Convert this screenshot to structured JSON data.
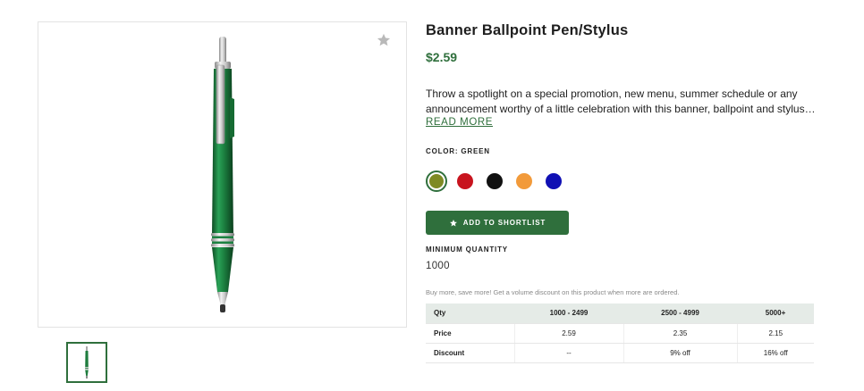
{
  "product": {
    "title": "Banner Ballpoint Pen/Stylus",
    "price": "$2.59",
    "description": "Throw a spotlight on a special promotion, new menu, summer schedule or any announcement worthy of a little celebration with this banner, ballpoint and stylus…",
    "read_more": "READ MORE"
  },
  "icons": {
    "favorite": "star-icon",
    "shortlist": "star-icon"
  },
  "color": {
    "label": "COLOR: GREEN",
    "options": [
      {
        "name": "green",
        "hex": "#7e8a24",
        "selected": true
      },
      {
        "name": "red",
        "hex": "#c8141e",
        "selected": false
      },
      {
        "name": "black",
        "hex": "#111111",
        "selected": false
      },
      {
        "name": "orange",
        "hex": "#f29a3a",
        "selected": false
      },
      {
        "name": "blue",
        "hex": "#1010b4",
        "selected": false
      }
    ]
  },
  "shortlist_button": "ADD TO SHORTLIST",
  "minimum_quantity": {
    "label": "MINIMUM QUANTITY",
    "value": "1000"
  },
  "discount_note": "Buy more, save more! Get a volume discount on this product when more are ordered.",
  "pricing_table": {
    "headers": [
      "Qty",
      "1000 - 2499",
      "2500 - 4999",
      "5000+"
    ],
    "rows": [
      [
        "Price",
        "2.59",
        "2.35",
        "2.15"
      ],
      [
        "Discount",
        "--",
        "9% off",
        "16% off"
      ]
    ]
  },
  "colors": {
    "brand_green": "#2f6f3c",
    "pen_green": "#1f7d3e",
    "table_header_bg": "#e5ebe7"
  }
}
